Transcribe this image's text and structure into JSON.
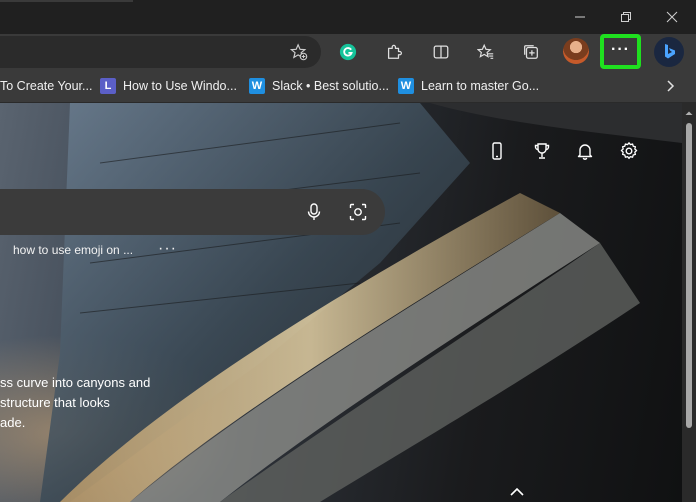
{
  "window": {
    "controls": {
      "minimize_icon": "minimize-icon",
      "restore_icon": "restore-icon",
      "close_icon": "close-icon"
    }
  },
  "toolbar": {
    "address_value": "",
    "icons": [
      "add-favorite-icon",
      "grammarly-icon",
      "extensions-icon",
      "split-screen-icon",
      "favorites-icon",
      "collections-icon",
      "profile-avatar",
      "more-options-icon",
      "bing-copilot-icon"
    ],
    "more_label": "···",
    "highlight_color": "#1fe01f"
  },
  "favorites": [
    {
      "label": "To Create Your...",
      "icon": "page-icon"
    },
    {
      "label": "How to Use Windo...",
      "icon": "L",
      "color": "#5b5fc7"
    },
    {
      "label": "Slack • Best solutio...",
      "icon": "W",
      "color": "#1f8fe0"
    },
    {
      "label": "Learn to master Go...",
      "icon": "W",
      "color": "#1f8fe0"
    }
  ],
  "newtab": {
    "search_value": "",
    "recent_search": "how to use emoji on ...",
    "recent_more": "···",
    "caption_lines": [
      "ss curve into canyons and",
      "structure that looks",
      "ade."
    ]
  }
}
